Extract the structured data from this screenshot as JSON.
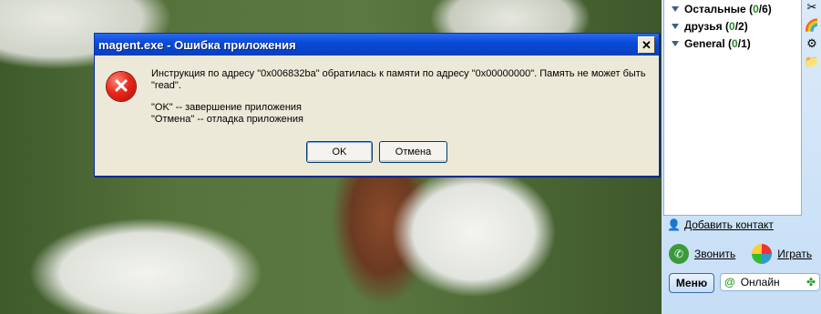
{
  "dialog": {
    "title": "magent.exe - Ошибка приложения",
    "close_label": "✕",
    "message_line1": "Инструкция по адресу \"0x006832ba\" обратилась к памяти по адресу \"0x00000000\". Память не может быть \"read\".",
    "message_line2": "\"OK\" -- завершение приложения",
    "message_line3": "\"Отмена\" -- отладка приложения",
    "ok_label": "OK",
    "cancel_label": "Отмена"
  },
  "messenger": {
    "groups": [
      {
        "name": "Остальные",
        "open": "(",
        "online": "0",
        "total": "/6)"
      },
      {
        "name": "друзья",
        "open": "(",
        "online": "0",
        "total": "/2)"
      },
      {
        "name": "General",
        "open": "(",
        "online": "0",
        "total": "/1)"
      }
    ],
    "add_contact": "Добавить контакт",
    "call": "Звонить",
    "play": "Играть",
    "menu": "Меню",
    "status": "Онлайн"
  }
}
